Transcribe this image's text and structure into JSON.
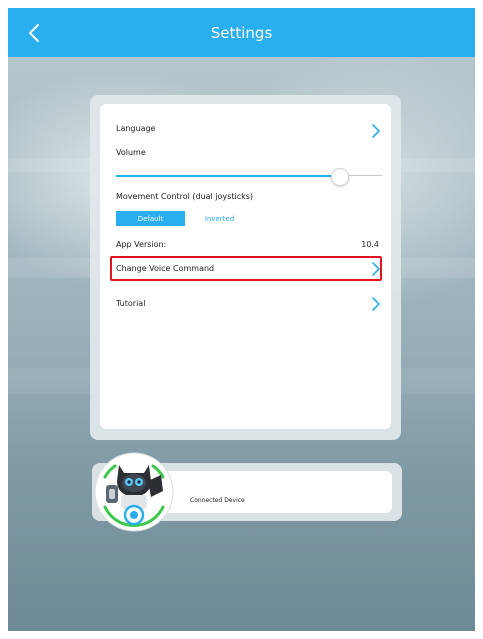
{
  "header": {
    "title": "Settings"
  },
  "settings": {
    "language_label": "Language",
    "volume_label": "Volume",
    "volume_level": 0.84,
    "movement_label": "Movement Control (dual joysticks)",
    "movement_options": [
      "Default",
      "Inverted"
    ],
    "movement_selected": "Default",
    "app_version_label": "App Version:",
    "app_version_value": "10.4",
    "voice_command_label": "Change Voice Command",
    "tutorial_label": "Tutorial"
  },
  "device": {
    "label": "Connected Device"
  },
  "colors": {
    "accent": "#29aef0",
    "highlight": "#e0141e",
    "ring": "#3cc84a"
  },
  "icons": {
    "back": "chevron-left-icon",
    "row_arrow": "chevron-right-icon"
  }
}
